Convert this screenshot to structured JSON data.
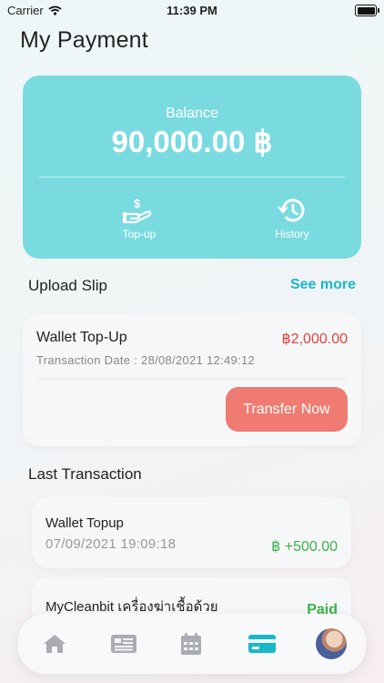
{
  "status_bar": {
    "carrier": "Carrier",
    "time": "11:39 PM"
  },
  "page": {
    "title": "My Payment"
  },
  "balance_card": {
    "label": "Balance",
    "amount": "90,000.00 ฿",
    "actions": [
      {
        "label": "Top-up",
        "icon": "topup-hand-dollar-icon"
      },
      {
        "label": "History",
        "icon": "history-clock-icon"
      }
    ],
    "color": "#79dbe0"
  },
  "upload_slip": {
    "title": "Upload Slip",
    "see_more": "See more",
    "item": {
      "title": "Wallet Top-Up",
      "amount": "฿2,000.00",
      "date": "Transaction Date : 28/08/2021 12:49:12",
      "button": "Transfer Now"
    }
  },
  "last_transaction": {
    "title": "Last Transaction",
    "items": [
      {
        "title": "Wallet Topup",
        "date": "07/09/2021 19:09:18",
        "amount": "฿ +500.00"
      },
      {
        "title": "MyCleanbit เครื่องฆ่าเชื้อด้วย",
        "status": "Paid"
      }
    ]
  },
  "bottom_nav": {
    "items": [
      {
        "name": "home",
        "icon": "home-icon"
      },
      {
        "name": "news",
        "icon": "news-icon"
      },
      {
        "name": "calendar",
        "icon": "calendar-icon"
      },
      {
        "name": "payment",
        "icon": "card-icon",
        "active": true
      },
      {
        "name": "profile",
        "icon": "avatar"
      }
    ],
    "active_color": "#17b8c7",
    "inactive_color": "#a9adb3"
  }
}
